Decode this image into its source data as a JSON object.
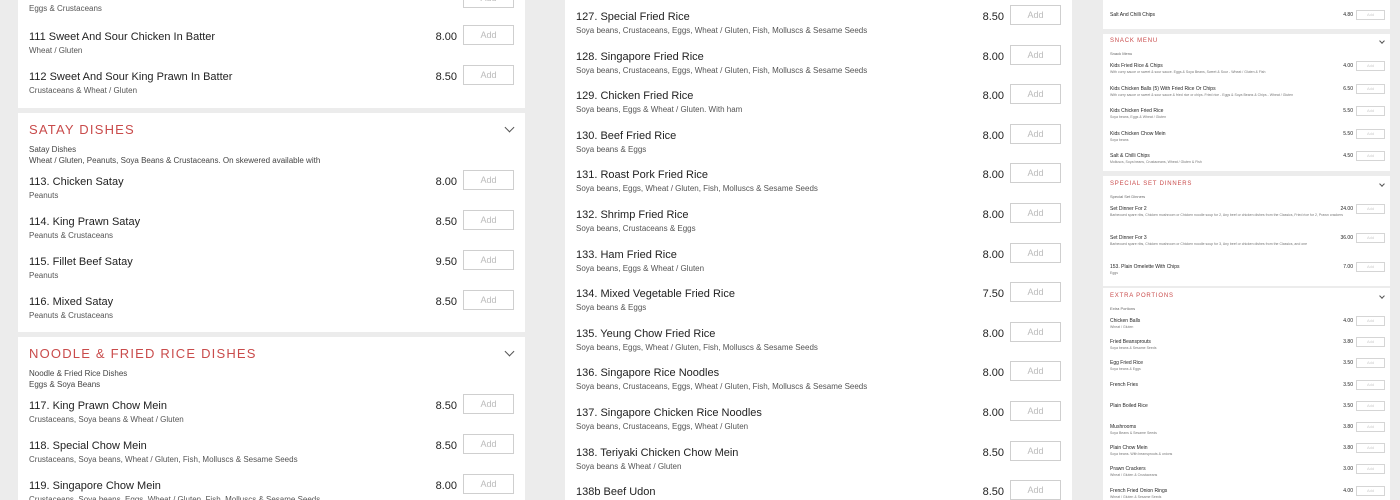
{
  "col1": {
    "top_item": {
      "desc": "Eggs & Crustaceans",
      "add": "Add"
    },
    "items_a": [
      {
        "name": "111 Sweet And Sour Chicken In Batter",
        "desc": "Wheat / Gluten",
        "price": "8.00",
        "add": "Add"
      },
      {
        "name": "112 Sweet And Sour King Prawn In Batter",
        "desc": "Crustaceans & Wheat / Gluten",
        "price": "8.50",
        "add": "Add"
      }
    ],
    "satay": {
      "title": "SATAY DISHES",
      "sub_title": "Satay Dishes",
      "sub_desc": "Wheat / Gluten, Peanuts, Soya Beans & Crustaceans. On skewered available with",
      "items": [
        {
          "name": "113. Chicken Satay",
          "desc": "Peanuts",
          "price": "8.00",
          "add": "Add"
        },
        {
          "name": "114. King Prawn Satay",
          "desc": "Peanuts & Crustaceans",
          "price": "8.50",
          "add": "Add"
        },
        {
          "name": "115. Fillet Beef Satay",
          "desc": "Peanuts",
          "price": "9.50",
          "add": "Add"
        },
        {
          "name": "116. Mixed Satay",
          "desc": "Peanuts & Crustaceans",
          "price": "8.50",
          "add": "Add"
        }
      ]
    },
    "noodle": {
      "title": "NOODLE & FRIED RICE DISHES",
      "sub_title": "Noodle & Fried Rice Dishes",
      "sub_desc": "Eggs & Soya Beans",
      "items": [
        {
          "name": "117. King Prawn Chow Mein",
          "desc": "Crustaceans, Soya beans & Wheat / Gluten",
          "price": "8.50",
          "add": "Add"
        },
        {
          "name": "118. Special Chow Mein",
          "desc": "Crustaceans, Soya beans, Wheat / Gluten, Fish, Molluscs & Sesame Seeds",
          "price": "8.50",
          "add": "Add"
        },
        {
          "name": "119. Singapore Chow Mein",
          "desc": "Crustaceans, Soya beans, Eggs, Wheat / Gluten, Fish, Molluscs & Sesame Seeds",
          "price": "8.00",
          "add": "Add"
        }
      ]
    }
  },
  "col2": {
    "items": [
      {
        "name": "127. Special Fried Rice",
        "desc": "Soya beans, Crustaceans, Eggs, Wheat / Gluten, Fish, Molluscs & Sesame Seeds",
        "price": "8.50",
        "add": "Add"
      },
      {
        "name": "128. Singapore Fried Rice",
        "desc": "Soya beans, Crustaceans, Eggs, Wheat / Gluten, Fish, Molluscs & Sesame Seeds",
        "price": "8.00",
        "add": "Add"
      },
      {
        "name": "129. Chicken Fried Rice",
        "desc": "Soya beans, Eggs & Wheat / Gluten. With ham",
        "price": "8.00",
        "add": "Add"
      },
      {
        "name": "130. Beef Fried Rice",
        "desc": "Soya beans & Eggs",
        "price": "8.00",
        "add": "Add"
      },
      {
        "name": "131. Roast Pork Fried Rice",
        "desc": "Soya beans, Eggs, Wheat / Gluten, Fish, Molluscs & Sesame Seeds",
        "price": "8.00",
        "add": "Add"
      },
      {
        "name": "132. Shrimp Fried Rice",
        "desc": "Soya beans, Crustaceans & Eggs",
        "price": "8.00",
        "add": "Add"
      },
      {
        "name": "133. Ham Fried Rice",
        "desc": "Soya beans, Eggs & Wheat / Gluten",
        "price": "8.00",
        "add": "Add"
      },
      {
        "name": "134. Mixed Vegetable Fried Rice",
        "desc": "Soya beans & Eggs",
        "price": "7.50",
        "add": "Add"
      },
      {
        "name": "135. Yeung Chow Fried Rice",
        "desc": "Soya beans, Eggs, Wheat / Gluten, Fish, Molluscs & Sesame Seeds",
        "price": "8.00",
        "add": "Add"
      },
      {
        "name": "136. Singapore Rice Noodles",
        "desc": "Soya beans, Crustaceans, Eggs, Wheat / Gluten, Fish, Molluscs & Sesame Seeds",
        "price": "8.00",
        "add": "Add"
      },
      {
        "name": "137. Singapore Chicken Rice Noodles",
        "desc": "Soya beans, Crustaceans, Eggs, Wheat / Gluten",
        "price": "8.00",
        "add": "Add"
      },
      {
        "name": "138. Teriyaki Chicken Chow Mein",
        "desc": "Soya beans & Wheat / Gluten",
        "price": "8.50",
        "add": "Add"
      },
      {
        "name": "138b Beef Udon",
        "desc": "",
        "price": "8.50",
        "add": "Add"
      }
    ]
  },
  "col3": {
    "top_item": {
      "name": "Salt And Chilli Chips",
      "price": "4.80",
      "add": "Add"
    },
    "snack": {
      "title": "SNACK MENU",
      "sub": "Snack Menu",
      "items": [
        {
          "name": "Kids Fried Rice & Chips",
          "desc": "With curry sauce or sweet & sour sauce. Eggs & Soya Beans, Sweet & Sour - Wheat / Gluten & Fish",
          "price": "4.00",
          "add": "Add"
        },
        {
          "name": "Kids Chicken Balls (5) With Fried Rice Or Chips",
          "desc": "With curry sauce or sweet & sour sauce & fried rice or chips. Fried rice - Eggs & Soya Beans & Chips - Wheat / Gluten",
          "price": "6.50",
          "add": "Add"
        },
        {
          "name": "Kids Chicken Fried Rice",
          "desc": "Soya beans, Eggs & Wheat / Gluten",
          "price": "5.50",
          "add": "Add"
        },
        {
          "name": "Kids Chicken Chow Mein",
          "desc": "Soya beans",
          "price": "5.50",
          "add": "Add"
        },
        {
          "name": "Salt & Chilli Chips",
          "desc": "Molluscs, Soya beans, Crustaceans, Wheat / Gluten & Fish",
          "price": "4.50",
          "add": "Add"
        }
      ]
    },
    "set": {
      "title": "SPECIAL SET DINNERS",
      "sub": "Special Set Dinners",
      "items": [
        {
          "name": "Set Dinner For 2",
          "desc": "Barbecued spare ribs, Chicken mushroom or Chicken noodle soup for 2, Any beef or chicken dishes from the Classics, Fried rice for 2, Prawn crackers",
          "price": "24.00",
          "add": "Add"
        },
        {
          "name": "Set Dinner For 3",
          "desc": "Barbecued spare ribs, Chicken mushroom or Chicken noodle soup for 3, Any beef or chicken dishes from the Classics, and one",
          "price": "36.00",
          "add": "Add"
        },
        {
          "name": "153. Plain Omelette With Chips",
          "desc": "Eggs",
          "price": "7.00",
          "add": "Add"
        }
      ]
    },
    "extra": {
      "title": "EXTRA PORTIONS",
      "sub": "Extra Portions",
      "items": [
        {
          "name": "Chicken Balls",
          "desc": "Wheat / Gluten",
          "price": "4.00",
          "add": "Add"
        },
        {
          "name": "Fried Beansprouts",
          "desc": "Soya beans & Sesame Seeds",
          "price": "3.80",
          "add": "Add"
        },
        {
          "name": "Egg Fried Rice",
          "desc": "Soya beans & Eggs",
          "price": "3.50",
          "add": "Add"
        },
        {
          "name": "French Fries",
          "desc": "",
          "price": "3.50",
          "add": "Add"
        },
        {
          "name": "Plain Boiled Rice",
          "desc": "",
          "price": "3.50",
          "add": "Add"
        },
        {
          "name": "Mushrooms",
          "desc": "Soya Beans & Sesame Seeds",
          "price": "3.80",
          "add": "Add"
        },
        {
          "name": "Plain Chow Mein",
          "desc": "Soya beans. With beansprouts & onions",
          "price": "3.80",
          "add": "Add"
        },
        {
          "name": "Prawn Crackers",
          "desc": "Wheat / Gluten & Crustaceans",
          "price": "3.00",
          "add": "Add"
        },
        {
          "name": "French Fried Onion Rings",
          "desc": "Wheat / Gluten & Sesame Seeds",
          "price": "4.00",
          "add": "Add"
        }
      ]
    }
  }
}
